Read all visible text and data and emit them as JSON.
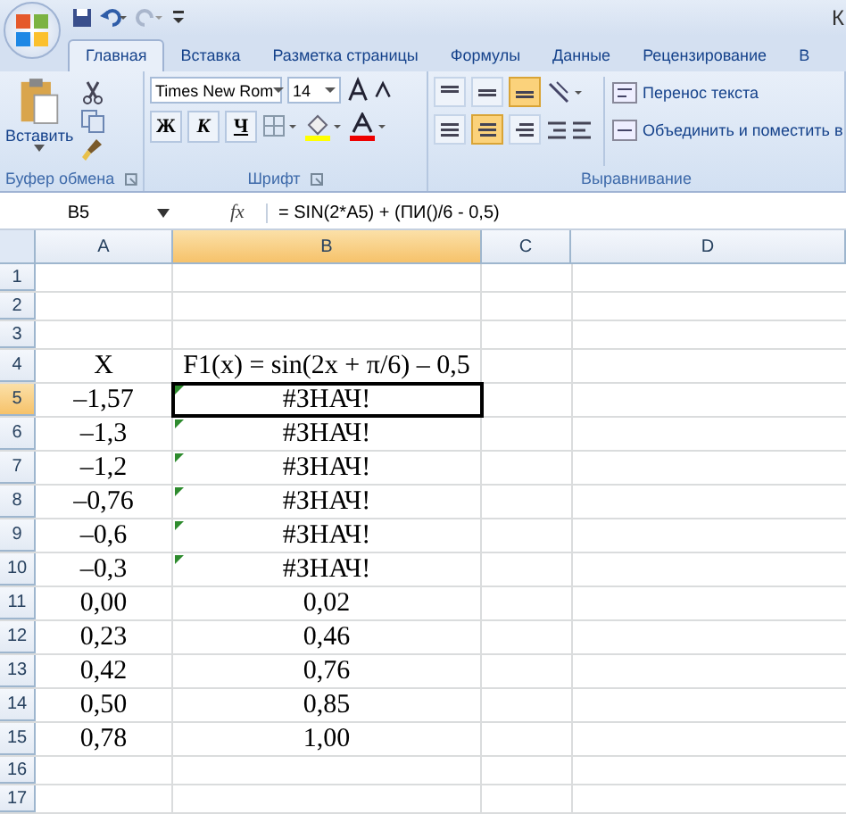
{
  "title": "К",
  "tabs": [
    {
      "label": "Главная",
      "selected": true
    },
    {
      "label": "Вставка",
      "selected": false
    },
    {
      "label": "Разметка страницы",
      "selected": false
    },
    {
      "label": "Формулы",
      "selected": false
    },
    {
      "label": "Данные",
      "selected": false
    },
    {
      "label": "Рецензирование",
      "selected": false
    },
    {
      "label": "В",
      "selected": false
    }
  ],
  "ribbon": {
    "clipboard": {
      "paste_label": "Вставить",
      "group_label": "Буфер обмена"
    },
    "font": {
      "font_name": "Times New Rom",
      "font_size": "14",
      "bold": "Ж",
      "italic": "К",
      "underline": "Ч",
      "group_label": "Шрифт"
    },
    "alignment": {
      "vertical": [
        {
          "selected": false
        },
        {
          "selected": false
        },
        {
          "selected": true
        }
      ],
      "horizontal": [
        {
          "selected": false
        },
        {
          "selected": true
        },
        {
          "selected": false
        }
      ],
      "wrap_text": "Перенос текста",
      "merge": "Объединить и поместить в",
      "group_label": "Выравнивание"
    }
  },
  "formula_bar": {
    "name_box": "B5",
    "fx": "fx",
    "formula": "= SIN(2*A5) + (ПИ()/6 - 0,5)"
  },
  "sheet": {
    "columns": [
      {
        "label": "A",
        "selected": false
      },
      {
        "label": "B",
        "selected": true
      },
      {
        "label": "C",
        "selected": false
      },
      {
        "label": "D",
        "selected": false
      }
    ],
    "rows": [
      {
        "number": "1",
        "selected": false
      },
      {
        "number": "2",
        "selected": false
      },
      {
        "number": "3",
        "selected": false
      },
      {
        "number": "4",
        "selected": false,
        "flag": false,
        "a": "X",
        "b": "F1(x) = sin(2x + π/6) – 0,5"
      },
      {
        "number": "5",
        "selected": true,
        "flag": true,
        "a": "–1,57",
        "b": "#ЗНАЧ!"
      },
      {
        "number": "6",
        "selected": false,
        "flag": true,
        "a": "–1,3",
        "b": "#ЗНАЧ!"
      },
      {
        "number": "7",
        "selected": false,
        "flag": true,
        "a": "–1,2",
        "b": "#ЗНАЧ!"
      },
      {
        "number": "8",
        "selected": false,
        "flag": true,
        "a": "–0,76",
        "b": "#ЗНАЧ!"
      },
      {
        "number": "9",
        "selected": false,
        "flag": true,
        "a": "–0,6",
        "b": "#ЗНАЧ!"
      },
      {
        "number": "10",
        "selected": false,
        "flag": true,
        "a": "–0,3",
        "b": "#ЗНАЧ!"
      },
      {
        "number": "11",
        "selected": false,
        "flag": false,
        "a": "0,00",
        "b": "0,02"
      },
      {
        "number": "12",
        "selected": false,
        "flag": false,
        "a": "0,23",
        "b": "0,46"
      },
      {
        "number": "13",
        "selected": false,
        "flag": false,
        "a": "0,42",
        "b": "0,76"
      },
      {
        "number": "14",
        "selected": false,
        "flag": false,
        "a": "0,50",
        "b": "0,85"
      },
      {
        "number": "15",
        "selected": false,
        "flag": false,
        "a": "0,78",
        "b": "1,00"
      },
      {
        "number": "16",
        "selected": false
      },
      {
        "number": "17",
        "selected": false
      }
    ]
  }
}
